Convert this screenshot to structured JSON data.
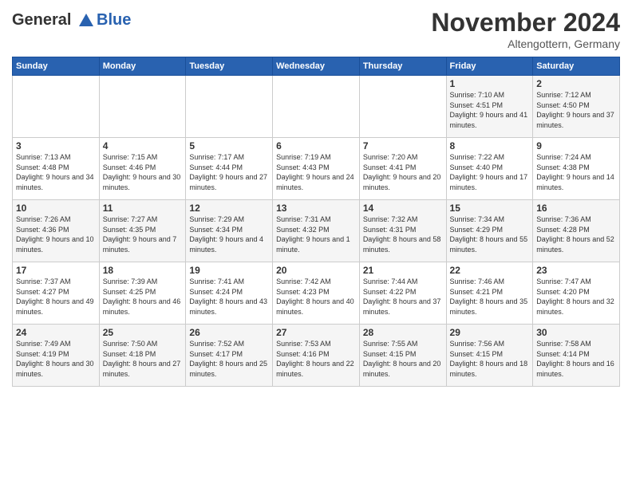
{
  "header": {
    "logo_line1": "General",
    "logo_line2": "Blue",
    "month_year": "November 2024",
    "location": "Altengottern, Germany"
  },
  "weekdays": [
    "Sunday",
    "Monday",
    "Tuesday",
    "Wednesday",
    "Thursday",
    "Friday",
    "Saturday"
  ],
  "weeks": [
    [
      {
        "day": "",
        "info": ""
      },
      {
        "day": "",
        "info": ""
      },
      {
        "day": "",
        "info": ""
      },
      {
        "day": "",
        "info": ""
      },
      {
        "day": "",
        "info": ""
      },
      {
        "day": "1",
        "info": "Sunrise: 7:10 AM\nSunset: 4:51 PM\nDaylight: 9 hours\nand 41 minutes."
      },
      {
        "day": "2",
        "info": "Sunrise: 7:12 AM\nSunset: 4:50 PM\nDaylight: 9 hours\nand 37 minutes."
      }
    ],
    [
      {
        "day": "3",
        "info": "Sunrise: 7:13 AM\nSunset: 4:48 PM\nDaylight: 9 hours\nand 34 minutes."
      },
      {
        "day": "4",
        "info": "Sunrise: 7:15 AM\nSunset: 4:46 PM\nDaylight: 9 hours\nand 30 minutes."
      },
      {
        "day": "5",
        "info": "Sunrise: 7:17 AM\nSunset: 4:44 PM\nDaylight: 9 hours\nand 27 minutes."
      },
      {
        "day": "6",
        "info": "Sunrise: 7:19 AM\nSunset: 4:43 PM\nDaylight: 9 hours\nand 24 minutes."
      },
      {
        "day": "7",
        "info": "Sunrise: 7:20 AM\nSunset: 4:41 PM\nDaylight: 9 hours\nand 20 minutes."
      },
      {
        "day": "8",
        "info": "Sunrise: 7:22 AM\nSunset: 4:40 PM\nDaylight: 9 hours\nand 17 minutes."
      },
      {
        "day": "9",
        "info": "Sunrise: 7:24 AM\nSunset: 4:38 PM\nDaylight: 9 hours\nand 14 minutes."
      }
    ],
    [
      {
        "day": "10",
        "info": "Sunrise: 7:26 AM\nSunset: 4:36 PM\nDaylight: 9 hours\nand 10 minutes."
      },
      {
        "day": "11",
        "info": "Sunrise: 7:27 AM\nSunset: 4:35 PM\nDaylight: 9 hours\nand 7 minutes."
      },
      {
        "day": "12",
        "info": "Sunrise: 7:29 AM\nSunset: 4:34 PM\nDaylight: 9 hours\nand 4 minutes."
      },
      {
        "day": "13",
        "info": "Sunrise: 7:31 AM\nSunset: 4:32 PM\nDaylight: 9 hours\nand 1 minute."
      },
      {
        "day": "14",
        "info": "Sunrise: 7:32 AM\nSunset: 4:31 PM\nDaylight: 8 hours\nand 58 minutes."
      },
      {
        "day": "15",
        "info": "Sunrise: 7:34 AM\nSunset: 4:29 PM\nDaylight: 8 hours\nand 55 minutes."
      },
      {
        "day": "16",
        "info": "Sunrise: 7:36 AM\nSunset: 4:28 PM\nDaylight: 8 hours\nand 52 minutes."
      }
    ],
    [
      {
        "day": "17",
        "info": "Sunrise: 7:37 AM\nSunset: 4:27 PM\nDaylight: 8 hours\nand 49 minutes."
      },
      {
        "day": "18",
        "info": "Sunrise: 7:39 AM\nSunset: 4:25 PM\nDaylight: 8 hours\nand 46 minutes."
      },
      {
        "day": "19",
        "info": "Sunrise: 7:41 AM\nSunset: 4:24 PM\nDaylight: 8 hours\nand 43 minutes."
      },
      {
        "day": "20",
        "info": "Sunrise: 7:42 AM\nSunset: 4:23 PM\nDaylight: 8 hours\nand 40 minutes."
      },
      {
        "day": "21",
        "info": "Sunrise: 7:44 AM\nSunset: 4:22 PM\nDaylight: 8 hours\nand 37 minutes."
      },
      {
        "day": "22",
        "info": "Sunrise: 7:46 AM\nSunset: 4:21 PM\nDaylight: 8 hours\nand 35 minutes."
      },
      {
        "day": "23",
        "info": "Sunrise: 7:47 AM\nSunset: 4:20 PM\nDaylight: 8 hours\nand 32 minutes."
      }
    ],
    [
      {
        "day": "24",
        "info": "Sunrise: 7:49 AM\nSunset: 4:19 PM\nDaylight: 8 hours\nand 30 minutes."
      },
      {
        "day": "25",
        "info": "Sunrise: 7:50 AM\nSunset: 4:18 PM\nDaylight: 8 hours\nand 27 minutes."
      },
      {
        "day": "26",
        "info": "Sunrise: 7:52 AM\nSunset: 4:17 PM\nDaylight: 8 hours\nand 25 minutes."
      },
      {
        "day": "27",
        "info": "Sunrise: 7:53 AM\nSunset: 4:16 PM\nDaylight: 8 hours\nand 22 minutes."
      },
      {
        "day": "28",
        "info": "Sunrise: 7:55 AM\nSunset: 4:15 PM\nDaylight: 8 hours\nand 20 minutes."
      },
      {
        "day": "29",
        "info": "Sunrise: 7:56 AM\nSunset: 4:15 PM\nDaylight: 8 hours\nand 18 minutes."
      },
      {
        "day": "30",
        "info": "Sunrise: 7:58 AM\nSunset: 4:14 PM\nDaylight: 8 hours\nand 16 minutes."
      }
    ]
  ]
}
